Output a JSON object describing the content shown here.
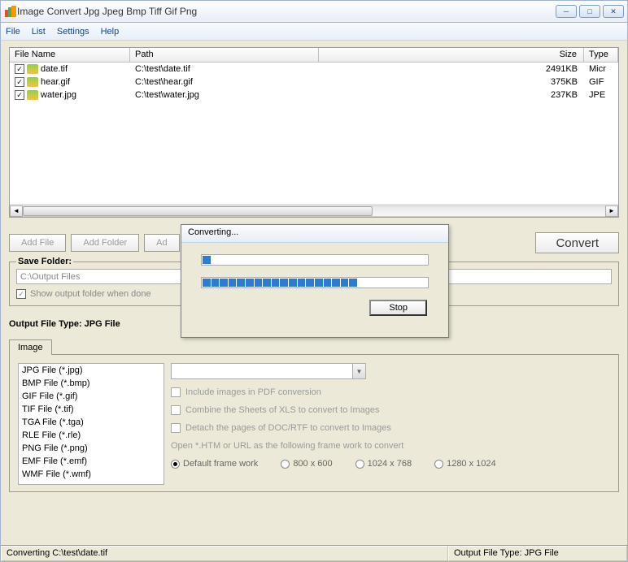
{
  "window": {
    "title": "Image Convert Jpg Jpeg Bmp Tiff Gif Png"
  },
  "menu": {
    "file": "File",
    "list": "List",
    "settings": "Settings",
    "help": "Help"
  },
  "grid": {
    "headers": {
      "name": "File Name",
      "path": "Path",
      "size": "Size",
      "type": "Type"
    },
    "rows": [
      {
        "name": "date.tif",
        "path": "C:\\test\\date.tif",
        "size": "2491KB",
        "type": "Micr"
      },
      {
        "name": "hear.gif",
        "path": "C:\\test\\hear.gif",
        "size": "375KB",
        "type": "GIF"
      },
      {
        "name": "water.jpg",
        "path": "C:\\test\\water.jpg",
        "size": "237KB",
        "type": "JPE"
      }
    ]
  },
  "buttons": {
    "add_file": "Add File",
    "add_folder": "Add Folder",
    "add_partial": "Ad",
    "convert": "Convert"
  },
  "save": {
    "label": "Save Folder:",
    "value": "C:\\Output Files",
    "show_output": "Show output folder when done"
  },
  "output_label": "Output File Type:  JPG File",
  "tab": {
    "label": "Image"
  },
  "types": [
    "JPG File  (*.jpg)",
    "BMP File  (*.bmp)",
    "GIF File  (*.gif)",
    "TIF File  (*.tif)",
    "TGA File  (*.tga)",
    "RLE File  (*.rle)",
    "PNG File  (*.png)",
    "EMF File  (*.emf)",
    "WMF File  (*.wmf)"
  ],
  "opts": {
    "pdf": "Include images in PDF conversion",
    "xls": "Combine the Sheets of XLS to convert to Images",
    "doc": "Detach the pages of DOC/RTF to convert to Images",
    "frame_label": "Open *.HTM or URL as the following frame work to convert",
    "r1": "Default frame work",
    "r2": "800 x 600",
    "r3": "1024 x 768",
    "r4": "1280 x 1024"
  },
  "status": {
    "left": "Converting  C:\\test\\date.tif",
    "right": "Output File Type:  JPG File"
  },
  "dialog": {
    "title": "Converting...",
    "stop": "Stop",
    "p1_segments": 1,
    "p2_segments": 18,
    "total_segments": 26
  }
}
